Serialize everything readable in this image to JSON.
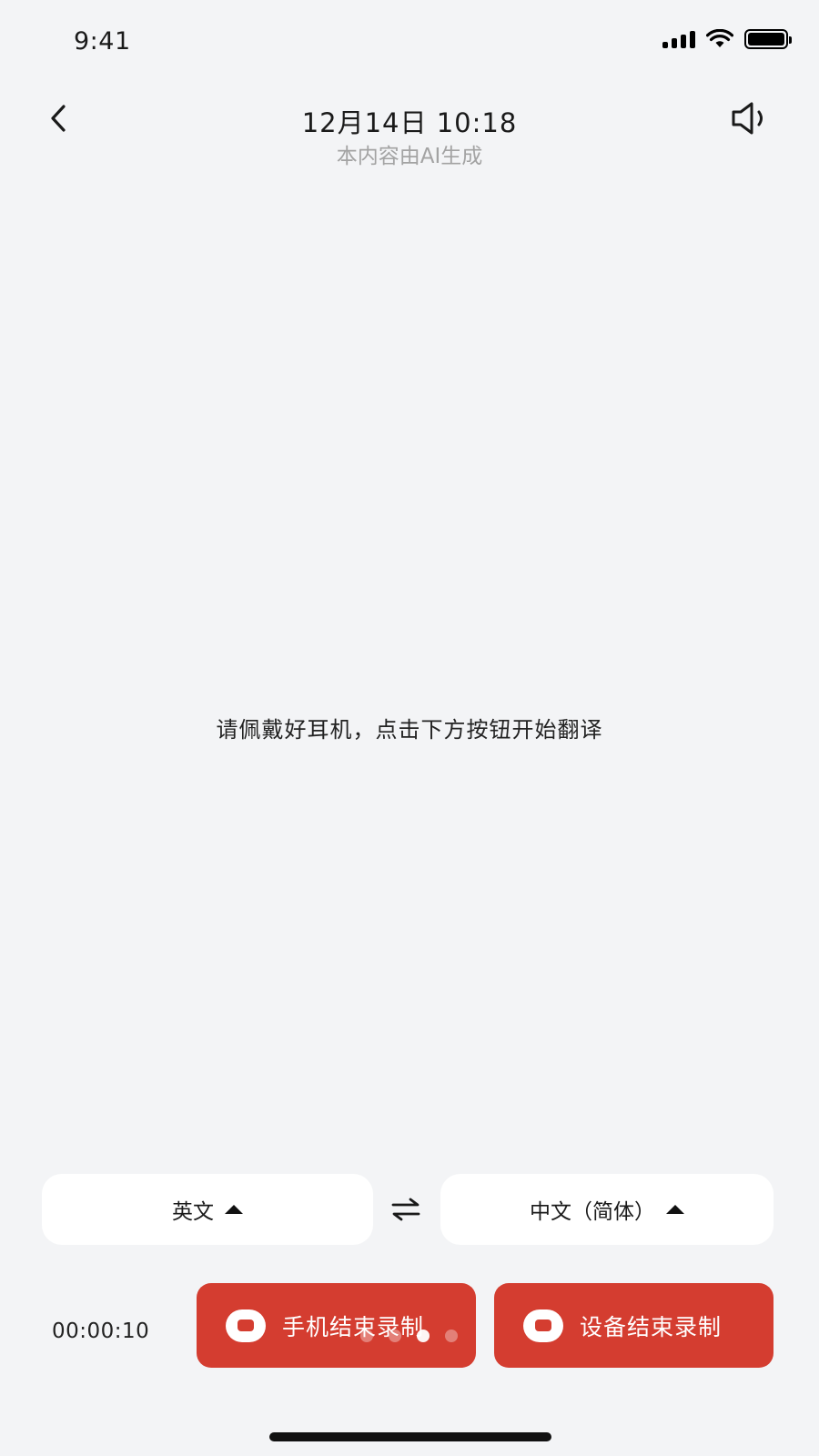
{
  "status_bar": {
    "time": "9:41",
    "icons": [
      "signal-icon",
      "wifi-icon",
      "battery-icon"
    ]
  },
  "header": {
    "title": "12月14日 10:18",
    "subtitle": "本内容由AI生成",
    "icons": [
      "back-arrow-icon",
      "speaker-icon"
    ]
  },
  "main": {
    "prompt": "请佩戴好耳机，点击下方按钮开始翻译"
  },
  "language": {
    "source": "英文",
    "target": "中文（简体）",
    "swap_icon": "swap-arrows-icon"
  },
  "recording": {
    "timer": "00:00:10",
    "phone_stop_label": "手机结束录制",
    "device_stop_label": "设备结束录制",
    "button_color": "#d43d30",
    "pager_count": 4,
    "pager_active_index": 2
  },
  "colors": {
    "background": "#f3f4f6",
    "accent": "#d43d30",
    "subtitle": "#a3a3a3"
  }
}
